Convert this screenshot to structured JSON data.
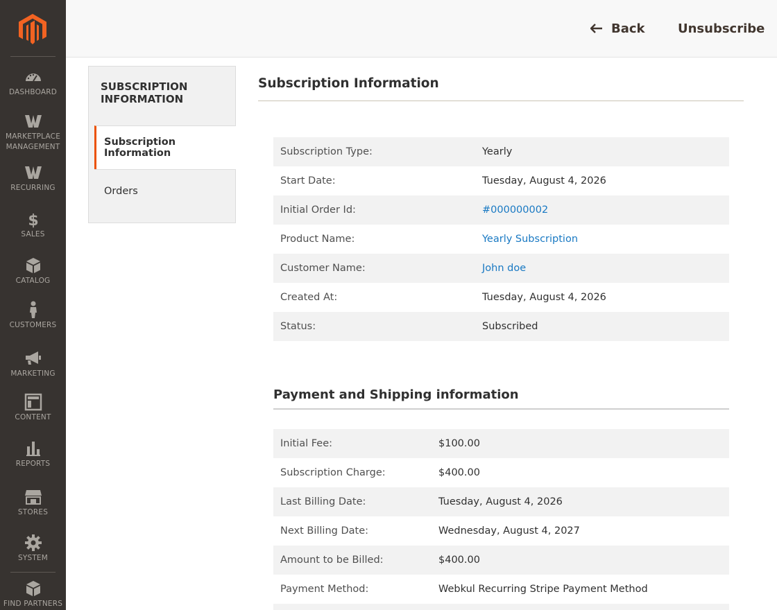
{
  "sidebar": {
    "items": [
      {
        "label": "DASHBOARD",
        "icon": "dashboard-icon"
      },
      {
        "label": "MARKETPLACE MANAGEMENT",
        "icon": "webkul-icon"
      },
      {
        "label": "RECURRING",
        "icon": "webkul-icon"
      },
      {
        "label": "SALES",
        "icon": "dollar-icon"
      },
      {
        "label": "CATALOG",
        "icon": "box-icon"
      },
      {
        "label": "CUSTOMERS",
        "icon": "person-icon"
      },
      {
        "label": "MARKETING",
        "icon": "megaphone-icon"
      },
      {
        "label": "CONTENT",
        "icon": "layout-icon"
      },
      {
        "label": "REPORTS",
        "icon": "bar-chart-icon"
      },
      {
        "label": "STORES",
        "icon": "storefront-icon"
      },
      {
        "label": "SYSTEM",
        "icon": "gear-icon"
      },
      {
        "label": "FIND PARTNERS",
        "icon": "cube-icon"
      }
    ]
  },
  "header": {
    "back_label": "Back",
    "unsubscribe_label": "Unsubscribe"
  },
  "tabs": {
    "title": "SUBSCRIPTION INFORMATION",
    "items": [
      {
        "label": "Subscription Information",
        "active": true
      },
      {
        "label": "Orders",
        "active": false
      }
    ]
  },
  "subscription": {
    "title": "Subscription Information",
    "rows": [
      {
        "label": "Subscription Type:",
        "value": "Yearly"
      },
      {
        "label": "Start Date:",
        "value": "Tuesday, August 4, 2026"
      },
      {
        "label": "Initial Order Id:",
        "value": "#000000002"
      },
      {
        "label": "Product Name:",
        "value": "Yearly Subscription"
      },
      {
        "label": "Customer Name:",
        "value": "John doe"
      },
      {
        "label": "Created At:",
        "value": "Tuesday, August 4, 2026"
      },
      {
        "label": "Status:",
        "value": "Subscribed"
      }
    ]
  },
  "payment": {
    "title": "Payment and Shipping information",
    "rows": [
      {
        "label": "Initial Fee:",
        "value": "$100.00"
      },
      {
        "label": "Subscription Charge:",
        "value": "$400.00"
      },
      {
        "label": "Last Billing Date:",
        "value": "Tuesday, August 4, 2026"
      },
      {
        "label": "Next Billing Date:",
        "value": "Wednesday, August 4, 2027"
      },
      {
        "label": "Amount to be Billed:",
        "value": "$400.00"
      },
      {
        "label": "Payment Method:",
        "value": "Webkul Recurring Stripe Payment Method"
      }
    ]
  },
  "colors": {
    "sidebar_bg": "#373330",
    "accent": "#eb5202",
    "link": "#1979c3"
  }
}
